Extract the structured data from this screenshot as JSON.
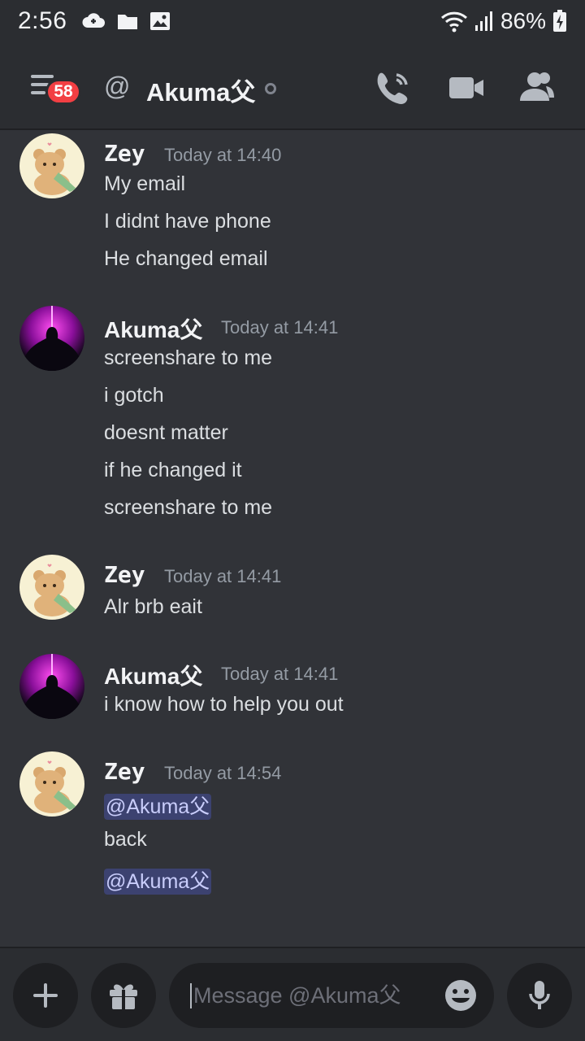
{
  "status_bar": {
    "time": "2:56",
    "battery": "86%"
  },
  "header": {
    "unread_count": "58",
    "at_symbol": "@",
    "title": "Akuma父"
  },
  "messages": [
    {
      "author": "Zey",
      "timestamp": "Today at 14:40",
      "lines": [
        "My email",
        "I didnt have phone",
        "He changed email"
      ]
    },
    {
      "author": "Akuma父",
      "timestamp": "Today at 14:41",
      "lines": [
        "screenshare to me",
        "i gotch",
        "doesnt matter",
        "if he changed it",
        "screenshare to me"
      ]
    },
    {
      "author": "Zey",
      "timestamp": "Today at 14:41",
      "lines": [
        "Alr brb eait"
      ]
    },
    {
      "author": "Akuma父",
      "timestamp": "Today at 14:41",
      "lines": [
        "i know how to help you out"
      ]
    },
    {
      "author": "Zey",
      "timestamp": "Today at 14:54",
      "lines": [
        "@Akuma父",
        "back",
        "@Akuma父"
      ]
    }
  ],
  "composer": {
    "placeholder": "Message @Akuma父"
  },
  "colors": {
    "background": "#313338",
    "header": "#2b2d31",
    "badge": "#f23f43",
    "mention_bg": "#3c4270",
    "mention_text": "#c9cdfb"
  },
  "icons": {
    "status_bar": [
      "cloud-sync-icon",
      "folder-icon",
      "gallery-icon",
      "wifi-icon",
      "signal-icon",
      "battery-charging-icon"
    ],
    "header": [
      "hamburger-menu-icon",
      "at-icon",
      "phone-call-icon",
      "video-call-icon",
      "members-icon"
    ],
    "composer": [
      "plus-icon",
      "gift-icon",
      "emoji-icon",
      "microphone-icon"
    ]
  }
}
